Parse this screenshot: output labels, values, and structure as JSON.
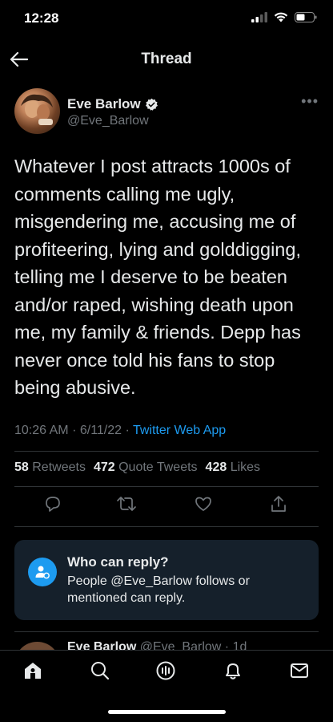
{
  "status_bar": {
    "time": "12:28"
  },
  "nav": {
    "title": "Thread"
  },
  "tweet": {
    "display_name": "Eve Barlow",
    "handle": "@Eve_Barlow",
    "text": "Whatever I post attracts 1000s of comments calling me ugly, misgendering me, accusing me of profiteering, lying and golddigging, telling me I deserve to be beaten and/or raped, wishing death upon me, my family & friends. Depp has never once told his fans to stop being abusive.",
    "time": "10:26 AM",
    "date": "6/11/22",
    "separator": "·",
    "source": "Twitter Web App",
    "stats": {
      "retweets_count": "58",
      "retweets_label": "Retweets",
      "quotes_count": "472",
      "quotes_label": "Quote Tweets",
      "likes_count": "428",
      "likes_label": "Likes"
    }
  },
  "reply_card": {
    "title": "Who can reply?",
    "description": "People @Eve_Barlow follows or mentioned can reply."
  },
  "next_tweet": {
    "display_name": "Eve Barlow",
    "handle": "@Eve_Barlow",
    "age": "· 1d"
  },
  "colors": {
    "background": "#000000",
    "link": "#1d9bf0",
    "muted": "#71767b",
    "card": "#15202b"
  },
  "icons": [
    "back-arrow-icon",
    "verified-badge-icon",
    "more-icon",
    "reply-icon",
    "retweet-icon",
    "like-icon",
    "share-icon",
    "home-icon",
    "search-icon",
    "spaces-icon",
    "notifications-icon",
    "messages-icon"
  ]
}
